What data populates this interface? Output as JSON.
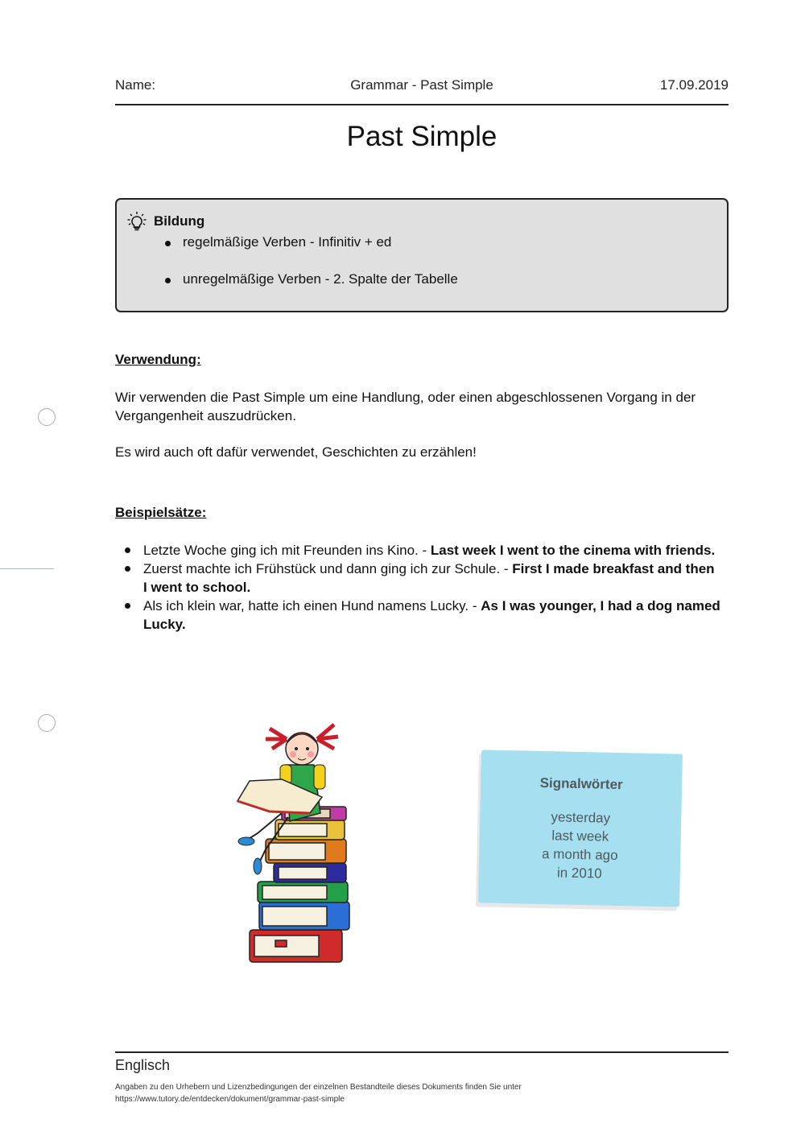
{
  "header": {
    "name_label": "Name:",
    "document_topic": "Grammar - Past Simple",
    "date": "17.09.2019"
  },
  "title": "Past Simple",
  "info_box": {
    "icon": "lightbulb-icon",
    "heading": "Bildung",
    "items": [
      "regelmäßige Verben - Infinitiv + ed",
      "unregelmäßige Verben - 2. Spalte der Tabelle"
    ]
  },
  "usage": {
    "heading": "Verwendung:",
    "paragraphs": [
      "Wir verwenden die Past Simple um eine Handlung, oder einen abgeschlossenen Vorgang in der Vergangenheit auszudrücken.",
      "Es wird auch oft dafür verwendet, Geschichten zu erzählen!"
    ]
  },
  "examples": {
    "heading": "Beispielsätze:",
    "items": [
      {
        "german": "Letzte Woche ging ich mit Freunden ins Kino. - ",
        "english": "Last week I went to the cinema with friends."
      },
      {
        "german": "Zuerst  machte ich Frühstück und dann ging ich zur Schule. - ",
        "english": "First I made breakfast and then I went to school."
      },
      {
        "german": "Als ich klein war, hatte ich einen Hund namens Lucky. - ",
        "english": "As I was younger, I had a dog named Lucky."
      }
    ]
  },
  "illustration": {
    "description": "girl reading on stack of books"
  },
  "signal_note": {
    "title": "Signalwörter",
    "words": [
      "yesterday",
      "last week",
      "a month ago",
      "in 2010"
    ],
    "color": "#a6dff0"
  },
  "footer": {
    "subject": "Englisch",
    "license_line1": "Angaben zu den Urhebern und Lizenzbedingungen der einzelnen Bestandteile dieses Dokuments finden Sie unter",
    "license_line2": "https://www.tutory.de/entdecken/dokument/grammar-past-simple"
  }
}
